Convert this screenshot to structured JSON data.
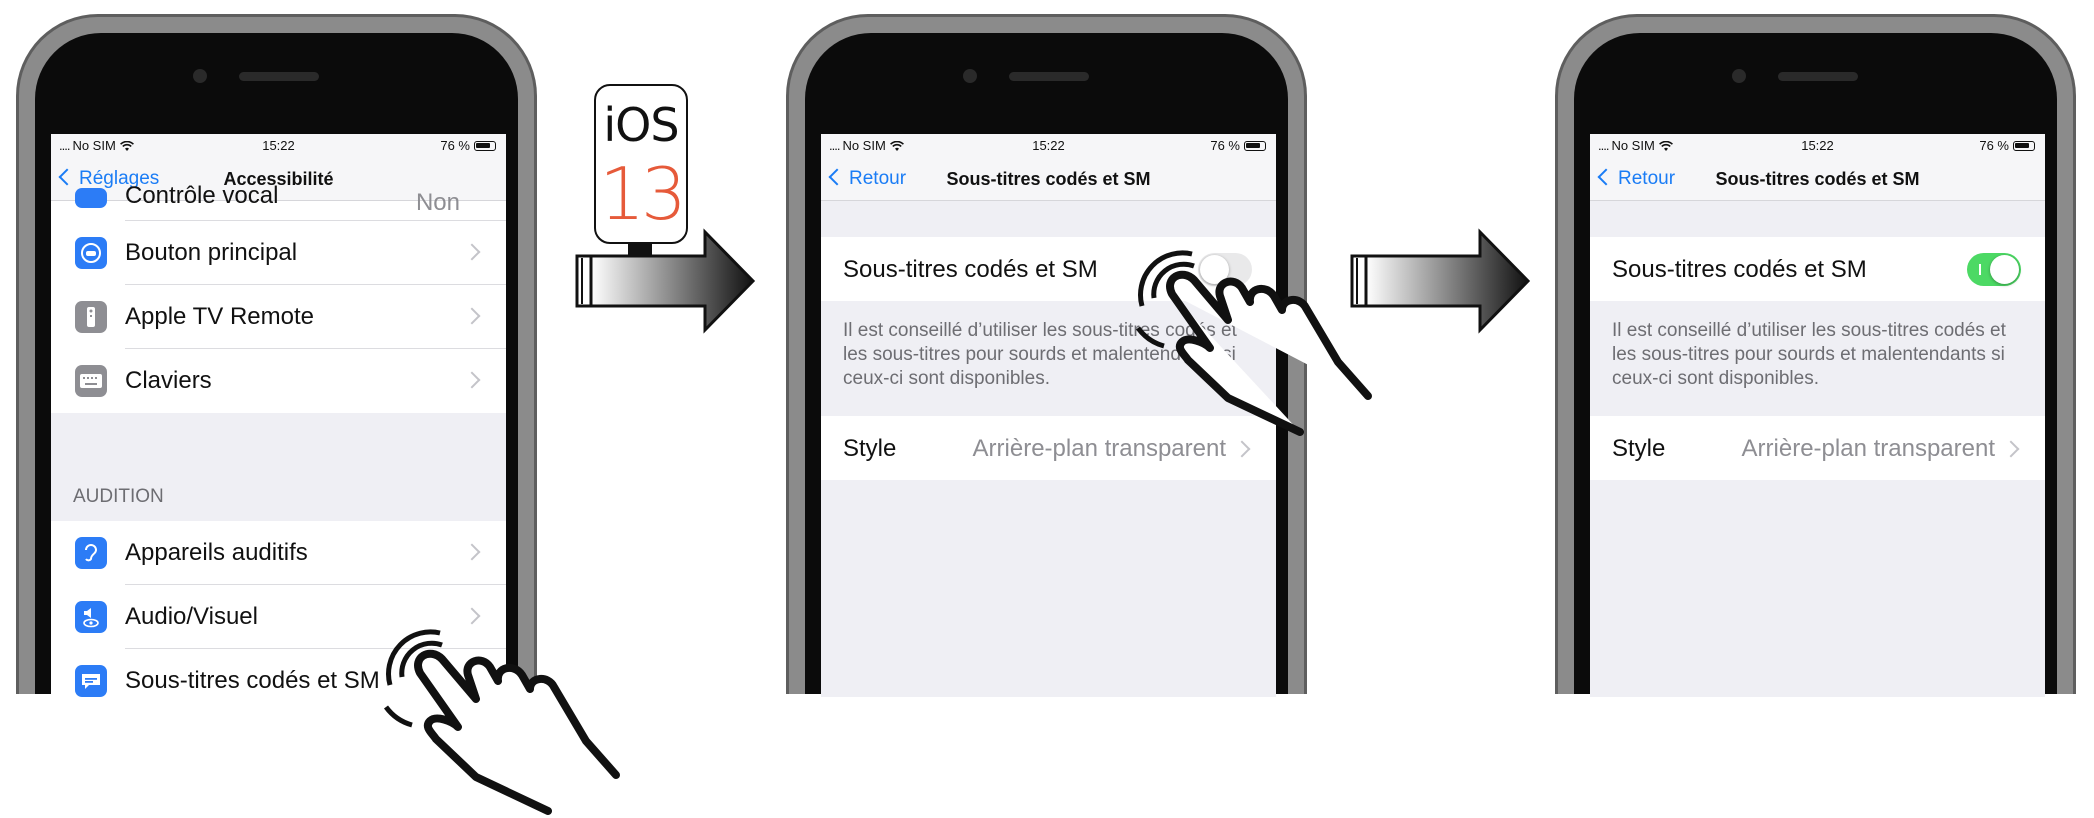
{
  "status": {
    "carrier": "No SIM",
    "time": "15:22",
    "battery": "76 %"
  },
  "badge": {
    "text": "iOS",
    "number": "13"
  },
  "screen1": {
    "back_label": "Réglages",
    "title": "Accessibilité",
    "partial_row": {
      "label": "Contrôle vocal",
      "value": "Non"
    },
    "rows": [
      {
        "label": "Bouton principal",
        "icon": "home-button-icon",
        "color": "#2c7cf6"
      },
      {
        "label": "Apple TV Remote",
        "icon": "remote-icon",
        "color": "#8e8e93"
      },
      {
        "label": "Claviers",
        "icon": "keyboard-icon",
        "color": "#8e8e93"
      }
    ],
    "section_header": "AUDITION",
    "rows2": [
      {
        "label": "Appareils auditifs",
        "icon": "ear-icon",
        "color": "#2c7cf6"
      },
      {
        "label": "Audio/Visuel",
        "icon": "audio-visual-icon",
        "color": "#2c7cf6"
      },
      {
        "label": "Sous-titres codés et SM",
        "icon": "captions-icon",
        "color": "#2c7cf6"
      }
    ]
  },
  "screen2": {
    "back_label": "Retour",
    "title": "Sous-titres codés et SM",
    "toggle_label": "Sous-titres codés et SM",
    "toggle_state": "off",
    "footnote": "Il est conseillé d’utiliser les sous-titres codés et les sous-titres pour sourds et malentendants si ceux-ci sont disponibles.",
    "style_label": "Style",
    "style_value": "Arrière-plan transparent"
  },
  "screen3": {
    "back_label": "Retour",
    "title": "Sous-titres codés et SM",
    "toggle_label": "Sous-titres codés et SM",
    "toggle_state": "on",
    "footnote": "Il est conseillé d’utiliser les sous-titres codés et les sous-titres pour sourds et malentendants si ceux-ci sont disponibles.",
    "style_label": "Style",
    "style_value": "Arrière-plan transparent"
  }
}
